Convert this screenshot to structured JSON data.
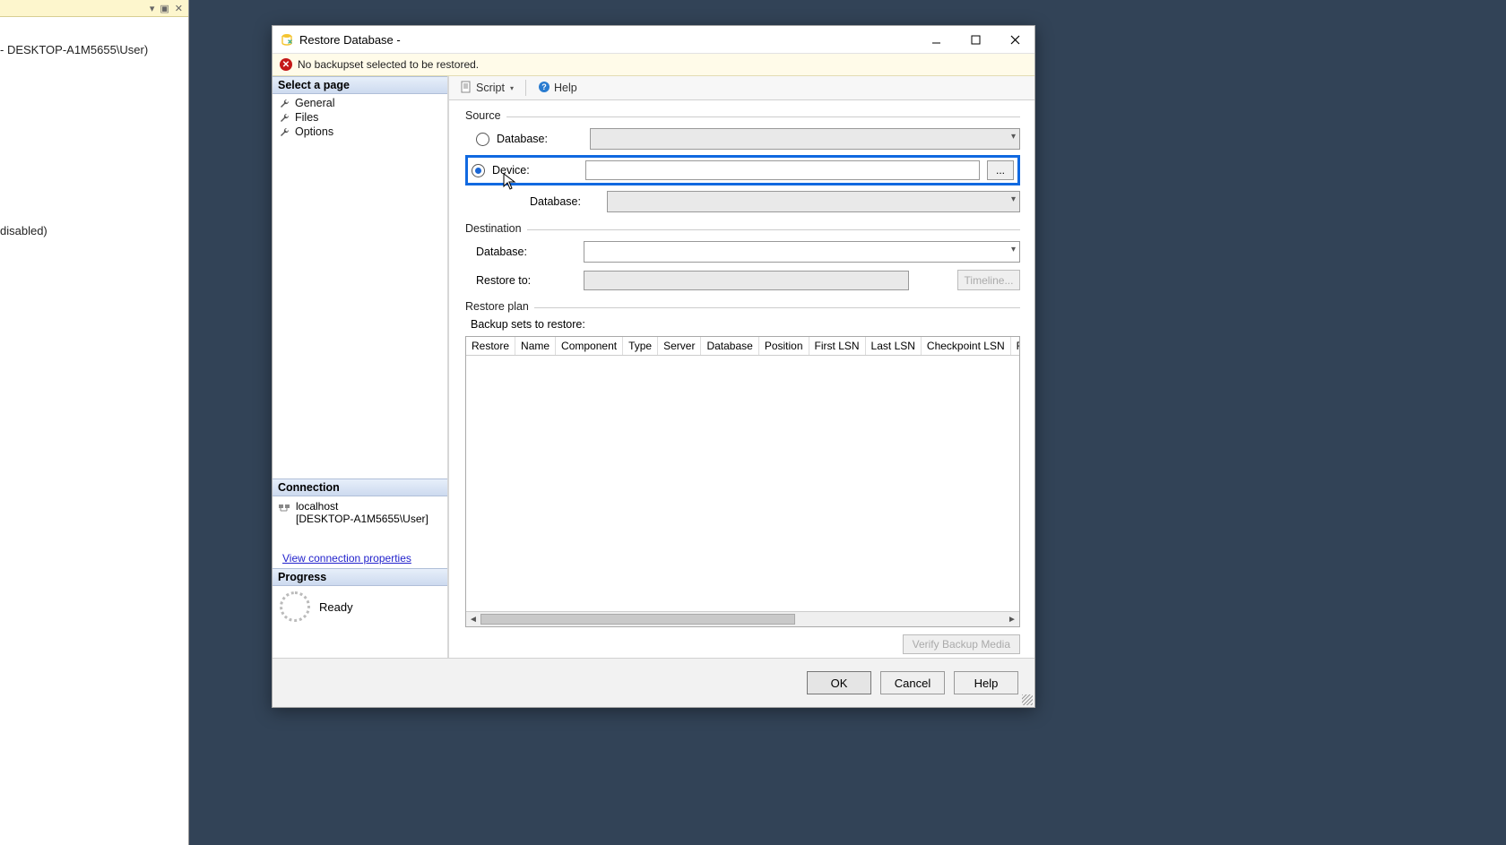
{
  "bg": {
    "snippet1": "- DESKTOP-A1M5655\\User)",
    "snippet2": "disabled)"
  },
  "dialog": {
    "title": "Restore Database -",
    "warning": "No backupset selected to be restored."
  },
  "pages": {
    "header": "Select a page",
    "items": [
      "General",
      "Files",
      "Options"
    ]
  },
  "connection": {
    "header": "Connection",
    "server": "localhost",
    "user": "[DESKTOP-A1M5655\\User]",
    "viewProps": "View connection properties"
  },
  "progress": {
    "header": "Progress",
    "status": "Ready"
  },
  "toolbar": {
    "script": "Script",
    "help": "Help"
  },
  "source": {
    "group": "Source",
    "databaseLabel": "Database:",
    "deviceLabel": "Device:",
    "subDatabaseLabel": "Database:",
    "browse": "..."
  },
  "destination": {
    "group": "Destination",
    "databaseLabel": "Database:",
    "restoreToLabel": "Restore to:",
    "timeline": "Timeline..."
  },
  "plan": {
    "group": "Restore plan",
    "backupSets": "Backup sets to restore:",
    "columns": [
      "Restore",
      "Name",
      "Component",
      "Type",
      "Server",
      "Database",
      "Position",
      "First LSN",
      "Last LSN",
      "Checkpoint LSN",
      "Full LS"
    ],
    "verify": "Verify Backup Media"
  },
  "footer": {
    "ok": "OK",
    "cancel": "Cancel",
    "help": "Help"
  }
}
